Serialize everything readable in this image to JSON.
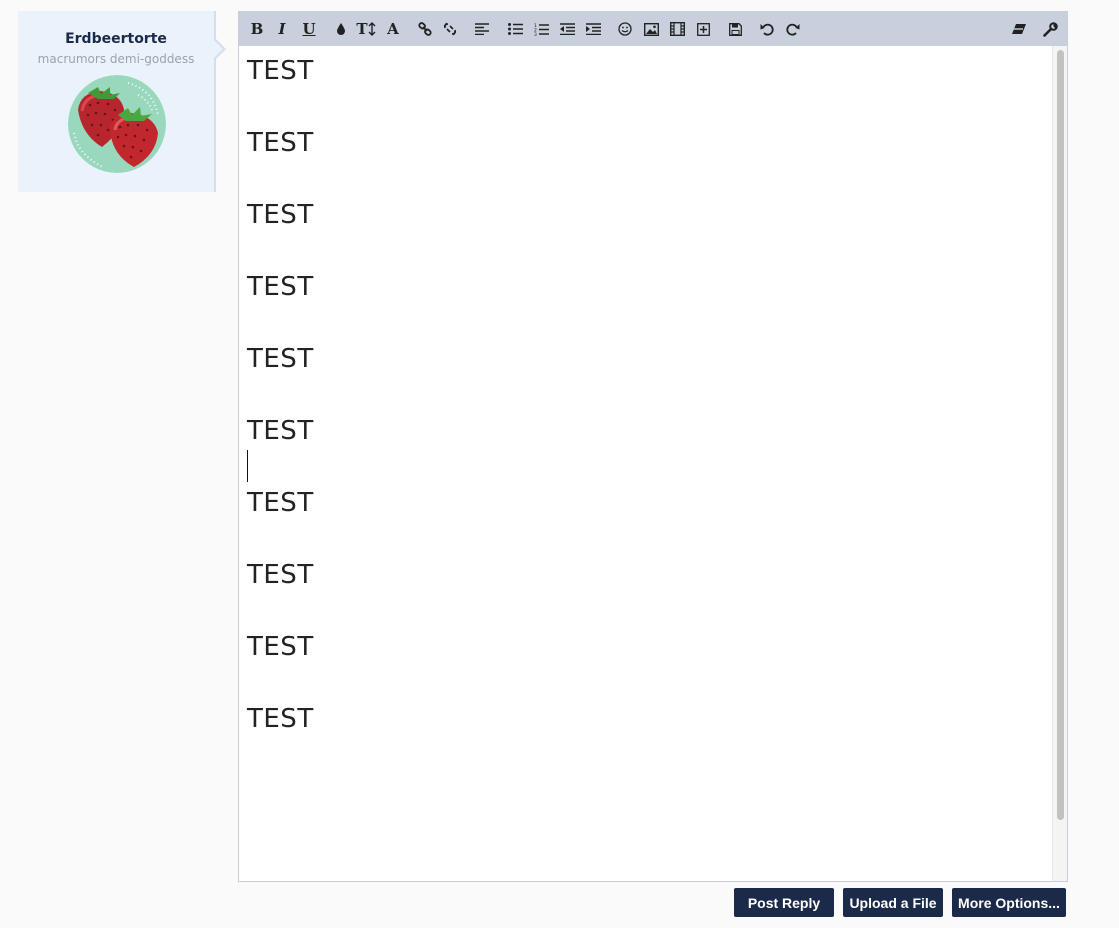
{
  "user": {
    "name": "Erdbeertorte",
    "title": "macrumors demi-goddess",
    "avatar": "strawberries-avatar"
  },
  "toolbar": {
    "bold": "B",
    "italic": "I",
    "underline": "U",
    "font_size": "T",
    "font_family": "A",
    "icons": [
      "bold-icon",
      "italic-icon",
      "underline-icon",
      "text-color-icon",
      "font-size-icon",
      "font-family-icon",
      "link-icon",
      "unlink-icon",
      "align-icon",
      "bulleted-list-icon",
      "numbered-list-icon",
      "outdent-icon",
      "indent-icon",
      "smilies-icon",
      "image-icon",
      "media-icon",
      "insert-icon",
      "save-draft-icon",
      "undo-icon",
      "redo-icon",
      "remove-formatting-icon",
      "settings-wrench-icon"
    ]
  },
  "editor": {
    "lines": [
      "TEST",
      "TEST",
      "TEST",
      "TEST",
      "TEST",
      "TEST",
      "TEST",
      "TEST",
      "TEST",
      "TEST"
    ]
  },
  "buttons": {
    "post_reply": "Post Reply",
    "upload_file": "Upload a File",
    "more_options": "More Options..."
  },
  "colors": {
    "navy": "#1b2a48",
    "toolbar_bg": "#c8d0dd",
    "card_bg": "#eaf2fb"
  }
}
